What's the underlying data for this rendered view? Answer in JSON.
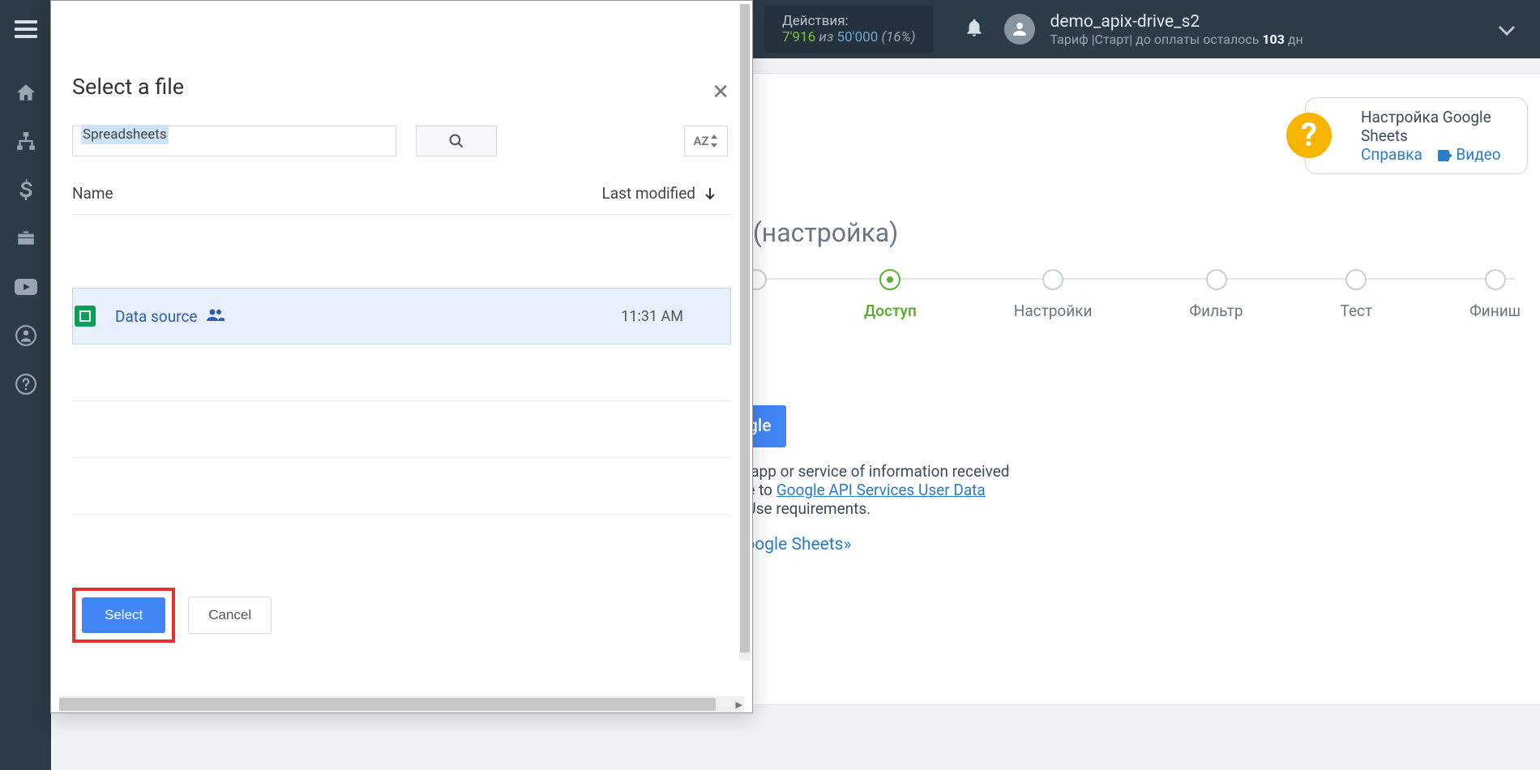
{
  "topbar": {
    "actions_title": "Действия:",
    "actions_used": "7'916",
    "actions_of_word": "из",
    "actions_limit": "50'000",
    "actions_pct": "(16%)",
    "account_name": "demo_apix-drive_s2",
    "tariff_prefix": "Тариф |Старт| до оплаты осталось ",
    "tariff_days": "103",
    "tariff_suffix": " дн"
  },
  "help": {
    "title": "Настройка Google Sheets",
    "link_ref": "Справка",
    "link_video": "Видео"
  },
  "page": {
    "setup_suffix": "х (настройка)"
  },
  "steps": {
    "s2": "Доступ",
    "s3": "Настройки",
    "s4": "Фильтр",
    "s5": "Тест",
    "s6": "Финиш"
  },
  "partial": {
    "btn_end": "gle",
    "t1a": "er app or service of information received",
    "t1b": "ere to ",
    "t1link": "Google API Services User Data",
    "t1c": "d Use requirements.",
    "t2": "Google Sheets»"
  },
  "picker": {
    "title": "Select a file",
    "type_filter": "Spreadsheets",
    "col_name": "Name",
    "col_modified": "Last modified",
    "sort_label": "AZ",
    "file_name": "Data source",
    "file_time": "11:31 AM",
    "select_btn": "Select",
    "cancel_btn": "Cancel"
  }
}
